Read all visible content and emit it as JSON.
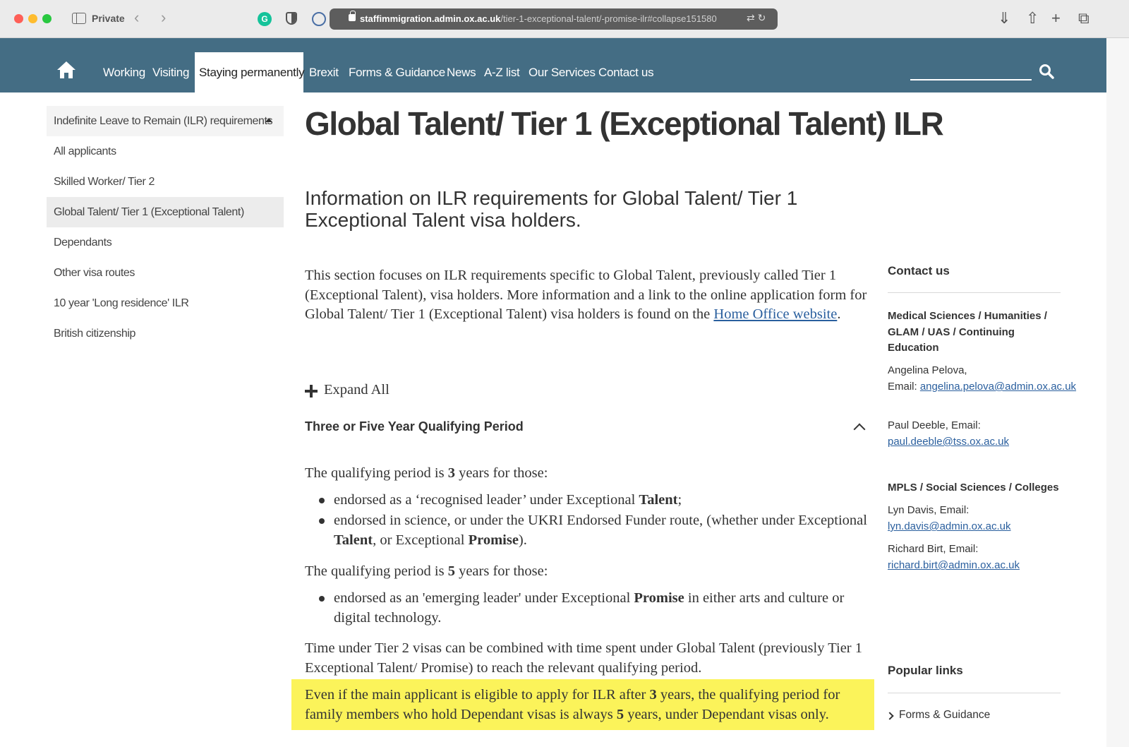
{
  "browser": {
    "private_label": "Private",
    "url_host": "staffimmigration.admin.ox.ac.uk",
    "url_path": "/tier-1-exceptional-talent/-promise-ilr#collapse151580"
  },
  "nav": {
    "items": [
      {
        "label": "Working"
      },
      {
        "label": "Visiting"
      },
      {
        "label": "Staying permanently",
        "active": true
      },
      {
        "label": "Brexit"
      },
      {
        "label": "Forms & Guidance"
      },
      {
        "label": "News"
      },
      {
        "label": "A-Z list"
      },
      {
        "label": "Our Services"
      },
      {
        "label": "Contact us"
      }
    ]
  },
  "sidebar": {
    "items": [
      {
        "label": "Indefinite Leave to Remain (ILR) requirements"
      },
      {
        "label": "All applicants"
      },
      {
        "label": "Skilled Worker/ Tier 2"
      },
      {
        "label": "Global Talent/ Tier 1 (Exceptional Talent)"
      },
      {
        "label": "Dependants"
      },
      {
        "label": "Other visa routes"
      },
      {
        "label": "10 year 'Long residence' ILR"
      },
      {
        "label": "British citizenship"
      }
    ]
  },
  "main": {
    "title": "Global Talent/ Tier 1 (Exceptional Talent) ILR",
    "subtitle": "Information on ILR requirements for Global Talent/ Tier 1 Exceptional Talent visa holders.",
    "intro": "This section focuses on ILR requirements specific to Global Talent, previously called Tier 1 (Exceptional Talent), visa holders. More information and a link to the online application form for Global Talent/ Tier 1 (Exceptional Talent) visa holders is found on the ",
    "intro_link": "Home Office website",
    "intro_end": ".",
    "expand_all": "Expand All",
    "accordion_title": "Three or Five Year Qualifying Period",
    "p1_a": "The qualifying period is ",
    "p1_b": "3",
    "p1_c": " years for those:",
    "b1_a": "endorsed as a ‘recognised leader’ under Exceptional ",
    "b1_b": "Talent",
    "b1_c": ";",
    "b2_a": "endorsed in science, or under the UKRI Endorsed Funder route, (whether under Exceptional ",
    "b2_b": "Talent",
    "b2_c": ", or Exceptional ",
    "b2_d": "Promise",
    "b2_e": ").",
    "p2_a": "The qualifying period is ",
    "p2_b": "5",
    "p2_c": " years for those:",
    "b3_a": "endorsed as an 'emerging leader' under Exceptional ",
    "b3_b": "Promise",
    "b3_c": " in either arts and culture or digital technology.",
    "p3": "Time under Tier 2 visas can be combined with time spent under Global Talent (previously Tier 1 Exceptional Talent/ Promise) to reach the relevant qualifying period.",
    "hl_a": "Even if the main applicant is eligible to apply for ILR after ",
    "hl_b": "3",
    "hl_c": " years, the qualifying period for family members who hold Dependant visas is always ",
    "hl_d": "5",
    "hl_e": " years, under Dependant visas only.",
    "highlight_color": "#fbf35a"
  },
  "contact": {
    "heading": "Contact us",
    "group1": "Medical Sciences / Humanities / GLAM / UAS / Continuing Education",
    "c1_name": "Angelina Pelova,",
    "c1_label": "Email: ",
    "c1_email": "angelina.pelova@admin.ox.ac.uk",
    "c2_name": "Paul Deeble, Email:",
    "c2_email": "paul.deeble@tss.ox.ac.uk",
    "group2": "MPLS / Social Sciences / Colleges",
    "c3_name": "Lyn Davis, Email:",
    "c3_email": "lyn.davis@admin.ox.ac.uk",
    "c4_name": "Richard Birt, Email:",
    "c4_email": "richard.birt@admin.ox.ac.uk"
  },
  "popular": {
    "heading": "Popular links",
    "item1": "Forms & Guidance"
  },
  "colors": {
    "nav_bg": "#446d84",
    "link": "#2a5f9e"
  }
}
